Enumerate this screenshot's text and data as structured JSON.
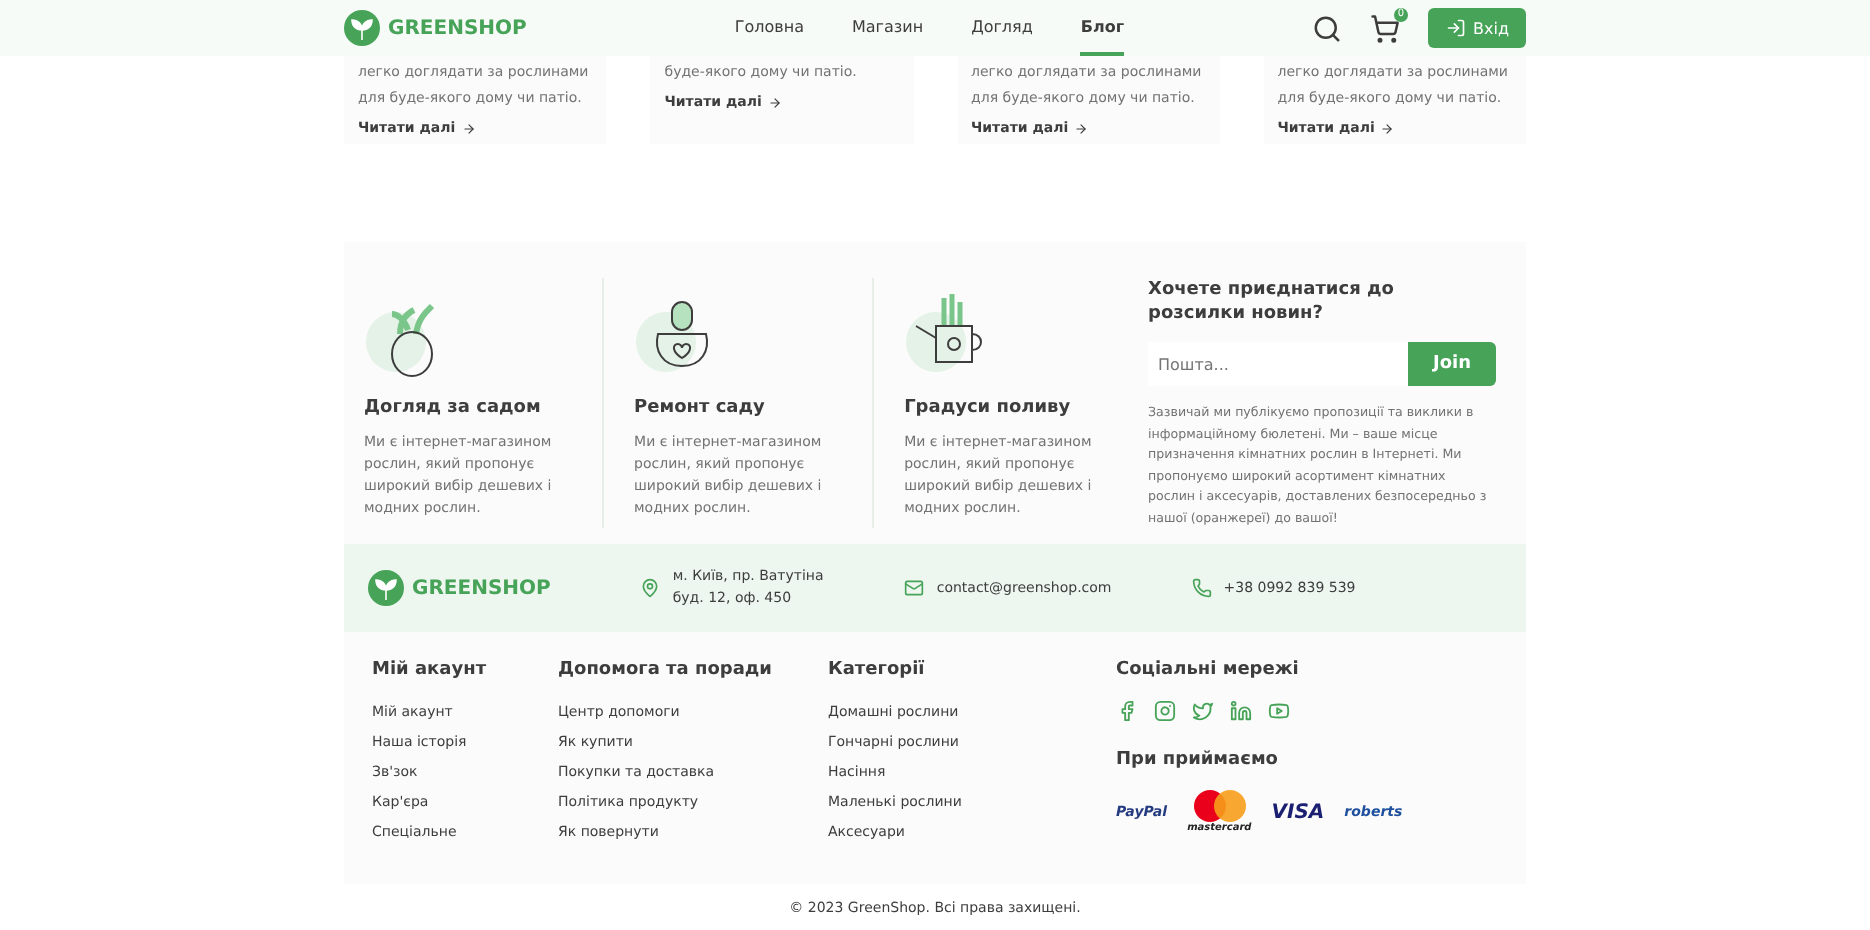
{
  "header": {
    "logo": "GREENSHOP",
    "nav": [
      {
        "label": "Головна",
        "selected": false
      },
      {
        "label": "Магазин",
        "selected": false
      },
      {
        "label": "Догляд",
        "selected": false
      },
      {
        "label": "Блог",
        "selected": true
      }
    ],
    "cart_count": "0",
    "login": "Вхід"
  },
  "blog_cards": [
    {
      "text": "легко доглядати за рослинами для буде-якого дому чи патіо.",
      "link": "Читати далі"
    },
    {
      "text": "буде-якого дому чи патіо.",
      "link": "Читати далі"
    },
    {
      "text": "легко доглядати за рослинами для буде-якого дому чи патіо.",
      "link": "Читати далі"
    },
    {
      "text": "легко доглядати за рослинами для буде-якого дому чи патіо.",
      "link": "Читати далі"
    }
  ],
  "features": [
    {
      "kind": "cactus",
      "title": "Догляд за садом",
      "text": "Ми є інтернет-магазином рослин, який пропонує широкий вибір дешевих і модних рослин."
    },
    {
      "kind": "pot",
      "title": "Ремонт саду",
      "text": "Ми є інтернет-магазином рослин, який пропонує широкий вибір дешевих і модних рослин."
    },
    {
      "kind": "can",
      "title": "Градуси поливу",
      "text": "Ми є інтернет-магазином рослин, який пропонує широкий вибір дешевих і модних рослин."
    }
  ],
  "newsletter": {
    "title": "Хочете приєднатися до розсилки новин?",
    "placeholder": "Пошта...",
    "button": "Join",
    "text": "Зазвичай ми публікуємо пропозиції та виклики в інформаційному бюлетені. Ми – ваше місце призначення кімнатних рослин в Інтернеті. Ми пропонуємо широкий асортимент кімнатних рослин і аксесуарів, доставлених безпосередньо з нашої (оранжереї) до вашої!"
  },
  "contact": {
    "logo": "GREENSHOP",
    "items": [
      {
        "kind": "location",
        "text": "м. Київ, пр. Ватутіна буд. 12, оф. 450"
      },
      {
        "kind": "mail",
        "text": "contact@greenshop.com"
      },
      {
        "kind": "phone",
        "text": "+38 0992 839 539"
      }
    ]
  },
  "link_columns": [
    {
      "title": "Мій акаунт",
      "links": [
        "Мій акаунт",
        "Наша історія",
        "Зв'зок",
        "Кар'єра",
        "Спеціальне"
      ]
    },
    {
      "title": "Допомога та поради",
      "links": [
        "Центр допомоги",
        "Як купити",
        "Покупки та доставка",
        "Політика продукту",
        "Як повернути"
      ]
    },
    {
      "title": "Категорії",
      "links": [
        "Домашні рослини",
        "Гончарні рослини",
        "Насіння",
        "Маленькі рослини",
        "Аксесуари"
      ]
    }
  ],
  "social": {
    "title": "Соціальні мережі"
  },
  "payments": {
    "title": "При приймаємо",
    "items": [
      {
        "kind": "paypal",
        "text": "PayPal"
      },
      {
        "kind": "mastercard",
        "text": "mastercard"
      },
      {
        "kind": "visa",
        "text": "VISA"
      },
      {
        "kind": "roberts",
        "text": "roberts"
      }
    ]
  },
  "copyright": "© 2023 GreenShop. Всі права захищені."
}
